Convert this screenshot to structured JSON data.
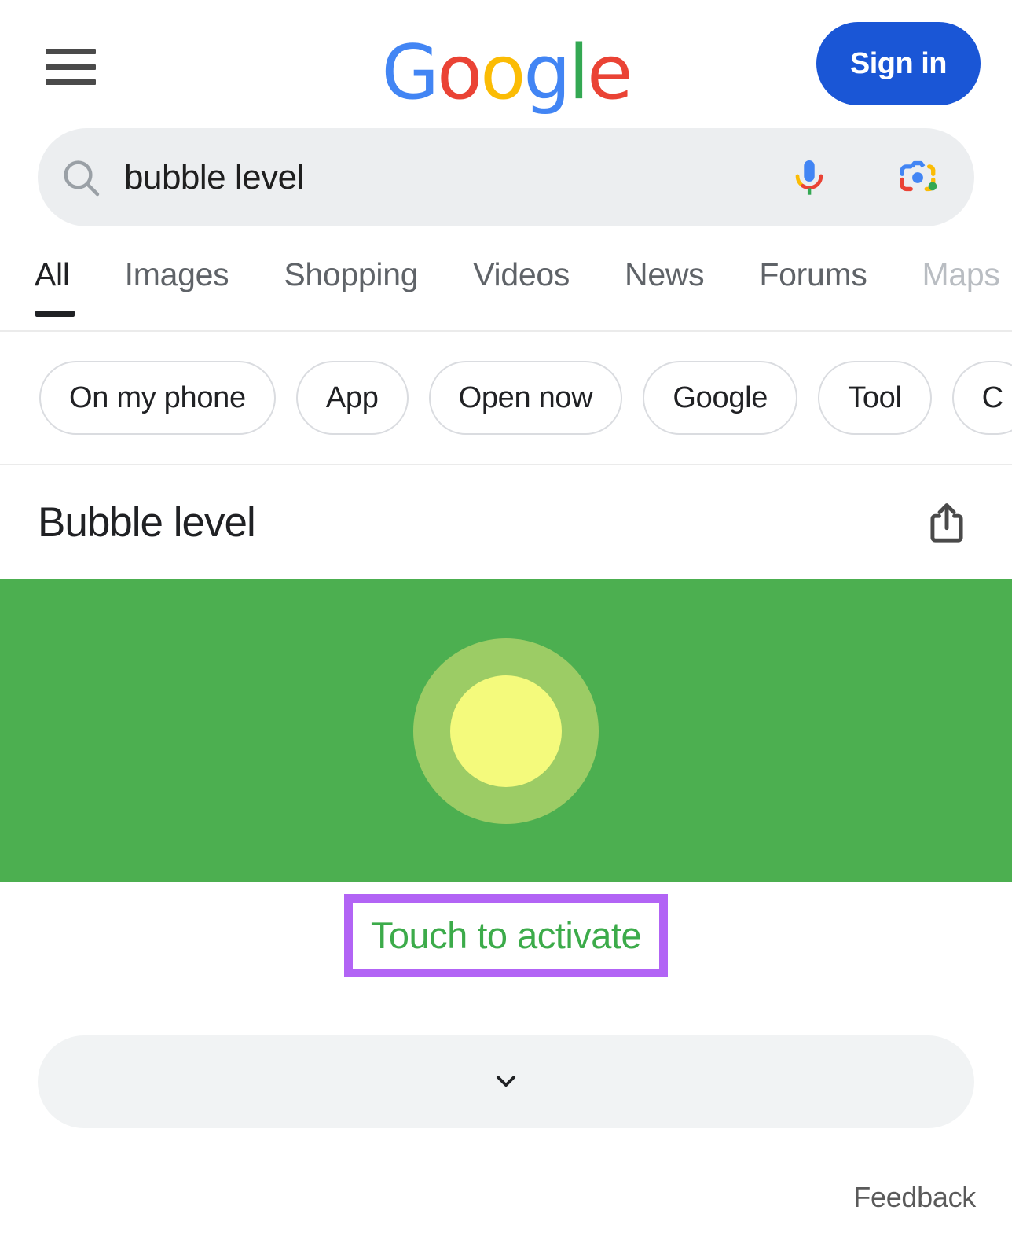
{
  "header": {
    "menu_icon": "hamburger-menu-icon",
    "logo_letters": [
      "G",
      "o",
      "o",
      "g",
      "l",
      "e"
    ],
    "signin_label": "Sign in",
    "signin_color": "#1A56D6"
  },
  "search": {
    "value": "bubble level",
    "placeholder": "Search",
    "search_icon": "search-icon",
    "mic_icon": "microphone-icon",
    "lens_icon": "google-lens-camera-icon"
  },
  "tabs": [
    {
      "label": "All",
      "active": true
    },
    {
      "label": "Images",
      "active": false
    },
    {
      "label": "Shopping",
      "active": false
    },
    {
      "label": "Videos",
      "active": false
    },
    {
      "label": "News",
      "active": false
    },
    {
      "label": "Forums",
      "active": false
    },
    {
      "label": "Maps",
      "active": false
    }
  ],
  "chips": [
    {
      "label": "On my phone"
    },
    {
      "label": "App"
    },
    {
      "label": "Open now"
    },
    {
      "label": "Google"
    },
    {
      "label": "Tool"
    },
    {
      "label": "C"
    }
  ],
  "result": {
    "title": "Bubble level",
    "share_icon": "share-icon"
  },
  "level_widget": {
    "background_color": "#4CAF50",
    "ring_color": "#9CCC65",
    "bubble_color": "#F4FA7C",
    "bubble_position": "centered"
  },
  "activate": {
    "label": "Touch to activate",
    "text_color": "#3cab4a",
    "highlight_color": "#b264f5"
  },
  "expand": {
    "icon": "chevron-down-icon"
  },
  "footer": {
    "feedback_label": "Feedback"
  }
}
